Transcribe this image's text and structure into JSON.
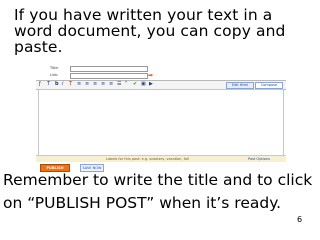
{
  "slide": {
    "heading_lines": [
      "If you have written your text in a",
      "word document, you can copy and",
      "paste."
    ],
    "body_lines": [
      "Remember to write the title and to click",
      "on “PUBLISH POST” when it’s ready."
    ],
    "page_number": "6"
  },
  "screenshot": {
    "title_label": "Title:",
    "link_label": "Link:",
    "arrow_glyph": "➡",
    "tabs": [
      "Edit Html",
      "Compose"
    ],
    "toolbar_icons": [
      "ƒ",
      "T",
      "b",
      "i",
      "T",
      "≡",
      "≡",
      "≡",
      "≡",
      "≡",
      "☰",
      "“",
      "✔",
      "▣",
      "▶"
    ],
    "tab_colors": {
      "border": "#8ba6d6",
      "fill": "#e6eefb"
    },
    "editor_bar_text": "Labels for this post: e.g. scooters, vacation, fall",
    "post_options": "Post Options",
    "publish_label": "PUBLISH POST",
    "save_label": "SAVE NOW",
    "publish_color": "#e8731c"
  }
}
